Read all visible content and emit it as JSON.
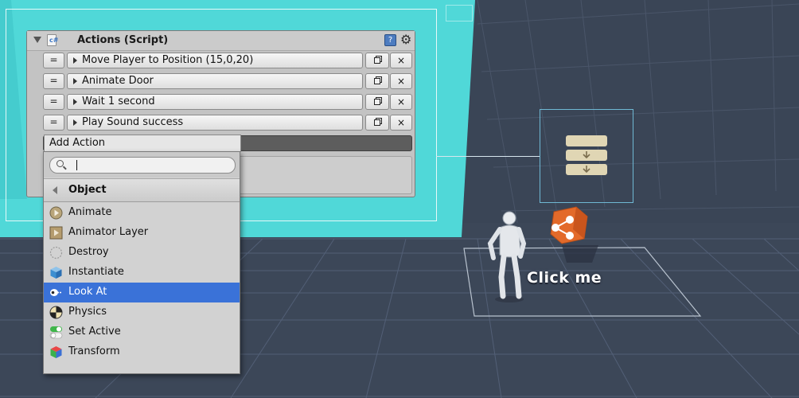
{
  "inspector": {
    "title": "Actions (Script)",
    "actions": [
      {
        "label": "Move Player to Position (15,0,20)"
      },
      {
        "label": "Animate Door"
      },
      {
        "label": "Wait 1 second"
      },
      {
        "label": "Play Sound success"
      }
    ],
    "handle_glyph": "=",
    "delete_glyph": "×",
    "add_action_label": "Add Action"
  },
  "dropdown": {
    "search_value": "",
    "category": "Object",
    "items": [
      {
        "label": "Animate",
        "icon": "animate-icon",
        "selected": false
      },
      {
        "label": "Animator Layer",
        "icon": "animator-layer-icon",
        "selected": false
      },
      {
        "label": "Destroy",
        "icon": "destroy-icon",
        "selected": false
      },
      {
        "label": "Instantiate",
        "icon": "instantiate-icon",
        "selected": false
      },
      {
        "label": "Look At",
        "icon": "look-at-icon",
        "selected": true
      },
      {
        "label": "Physics",
        "icon": "physics-icon",
        "selected": false
      },
      {
        "label": "Set Active",
        "icon": "set-active-icon",
        "selected": false
      },
      {
        "label": "Transform",
        "icon": "transform-icon",
        "selected": false
      }
    ]
  },
  "scene": {
    "click_label": "Click me"
  },
  "colors": {
    "selection": "#3a72d8",
    "cyan_wall": "#50d8d8",
    "scene_bg": "#3f4a5b"
  }
}
